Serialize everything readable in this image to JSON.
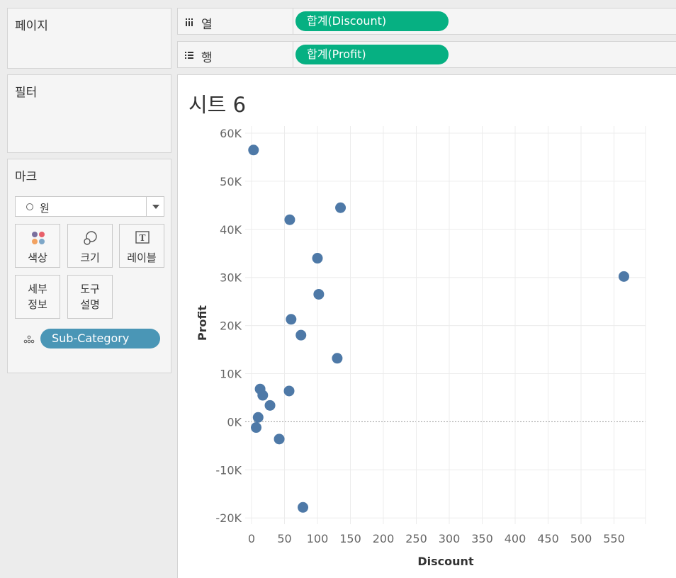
{
  "cards": {
    "pages": "페이지",
    "filters": "필터",
    "marks": "마크"
  },
  "marks": {
    "type": "원",
    "buttons": {
      "color": "색상",
      "size": "크기",
      "label": "레이블",
      "detail": "세부\n정보",
      "tooltip": "도구\n설명"
    },
    "detail_pill": "Sub-Category"
  },
  "shelves": {
    "columns_label": "열",
    "columns_pill": "합계(Discount)",
    "rows_label": "행",
    "rows_pill": "합계(Profit)"
  },
  "colors": {
    "pill_measure": "#06b082",
    "pill_dimension": "#4a96b6",
    "mark": "#4e79a7"
  },
  "sheet": {
    "title": "시트 6"
  },
  "chart_data": {
    "type": "scatter",
    "xlabel": "Discount",
    "ylabel": "Profit",
    "xlim": [
      0,
      600
    ],
    "ylim": [
      -20000,
      60000
    ],
    "x_ticks": [
      "0",
      "50",
      "100",
      "150",
      "200",
      "250",
      "300",
      "350",
      "400",
      "450",
      "500",
      "550"
    ],
    "y_ticks": [
      "60K",
      "50K",
      "40K",
      "30K",
      "20K",
      "10K",
      "0K",
      "-10K",
      "-20K"
    ],
    "grid": true,
    "points": [
      {
        "x": 3,
        "y": 56500
      },
      {
        "x": 135,
        "y": 44500
      },
      {
        "x": 58,
        "y": 42000
      },
      {
        "x": 100,
        "y": 34000
      },
      {
        "x": 565,
        "y": 30200
      },
      {
        "x": 102,
        "y": 26500
      },
      {
        "x": 60,
        "y": 21300
      },
      {
        "x": 75,
        "y": 18000
      },
      {
        "x": 130,
        "y": 13200
      },
      {
        "x": 13,
        "y": 6800
      },
      {
        "x": 57,
        "y": 6400
      },
      {
        "x": 17,
        "y": 5500
      },
      {
        "x": 28,
        "y": 3400
      },
      {
        "x": 10,
        "y": 900
      },
      {
        "x": 7,
        "y": -1200
      },
      {
        "x": 42,
        "y": -3600
      },
      {
        "x": 78,
        "y": -17800
      }
    ]
  }
}
